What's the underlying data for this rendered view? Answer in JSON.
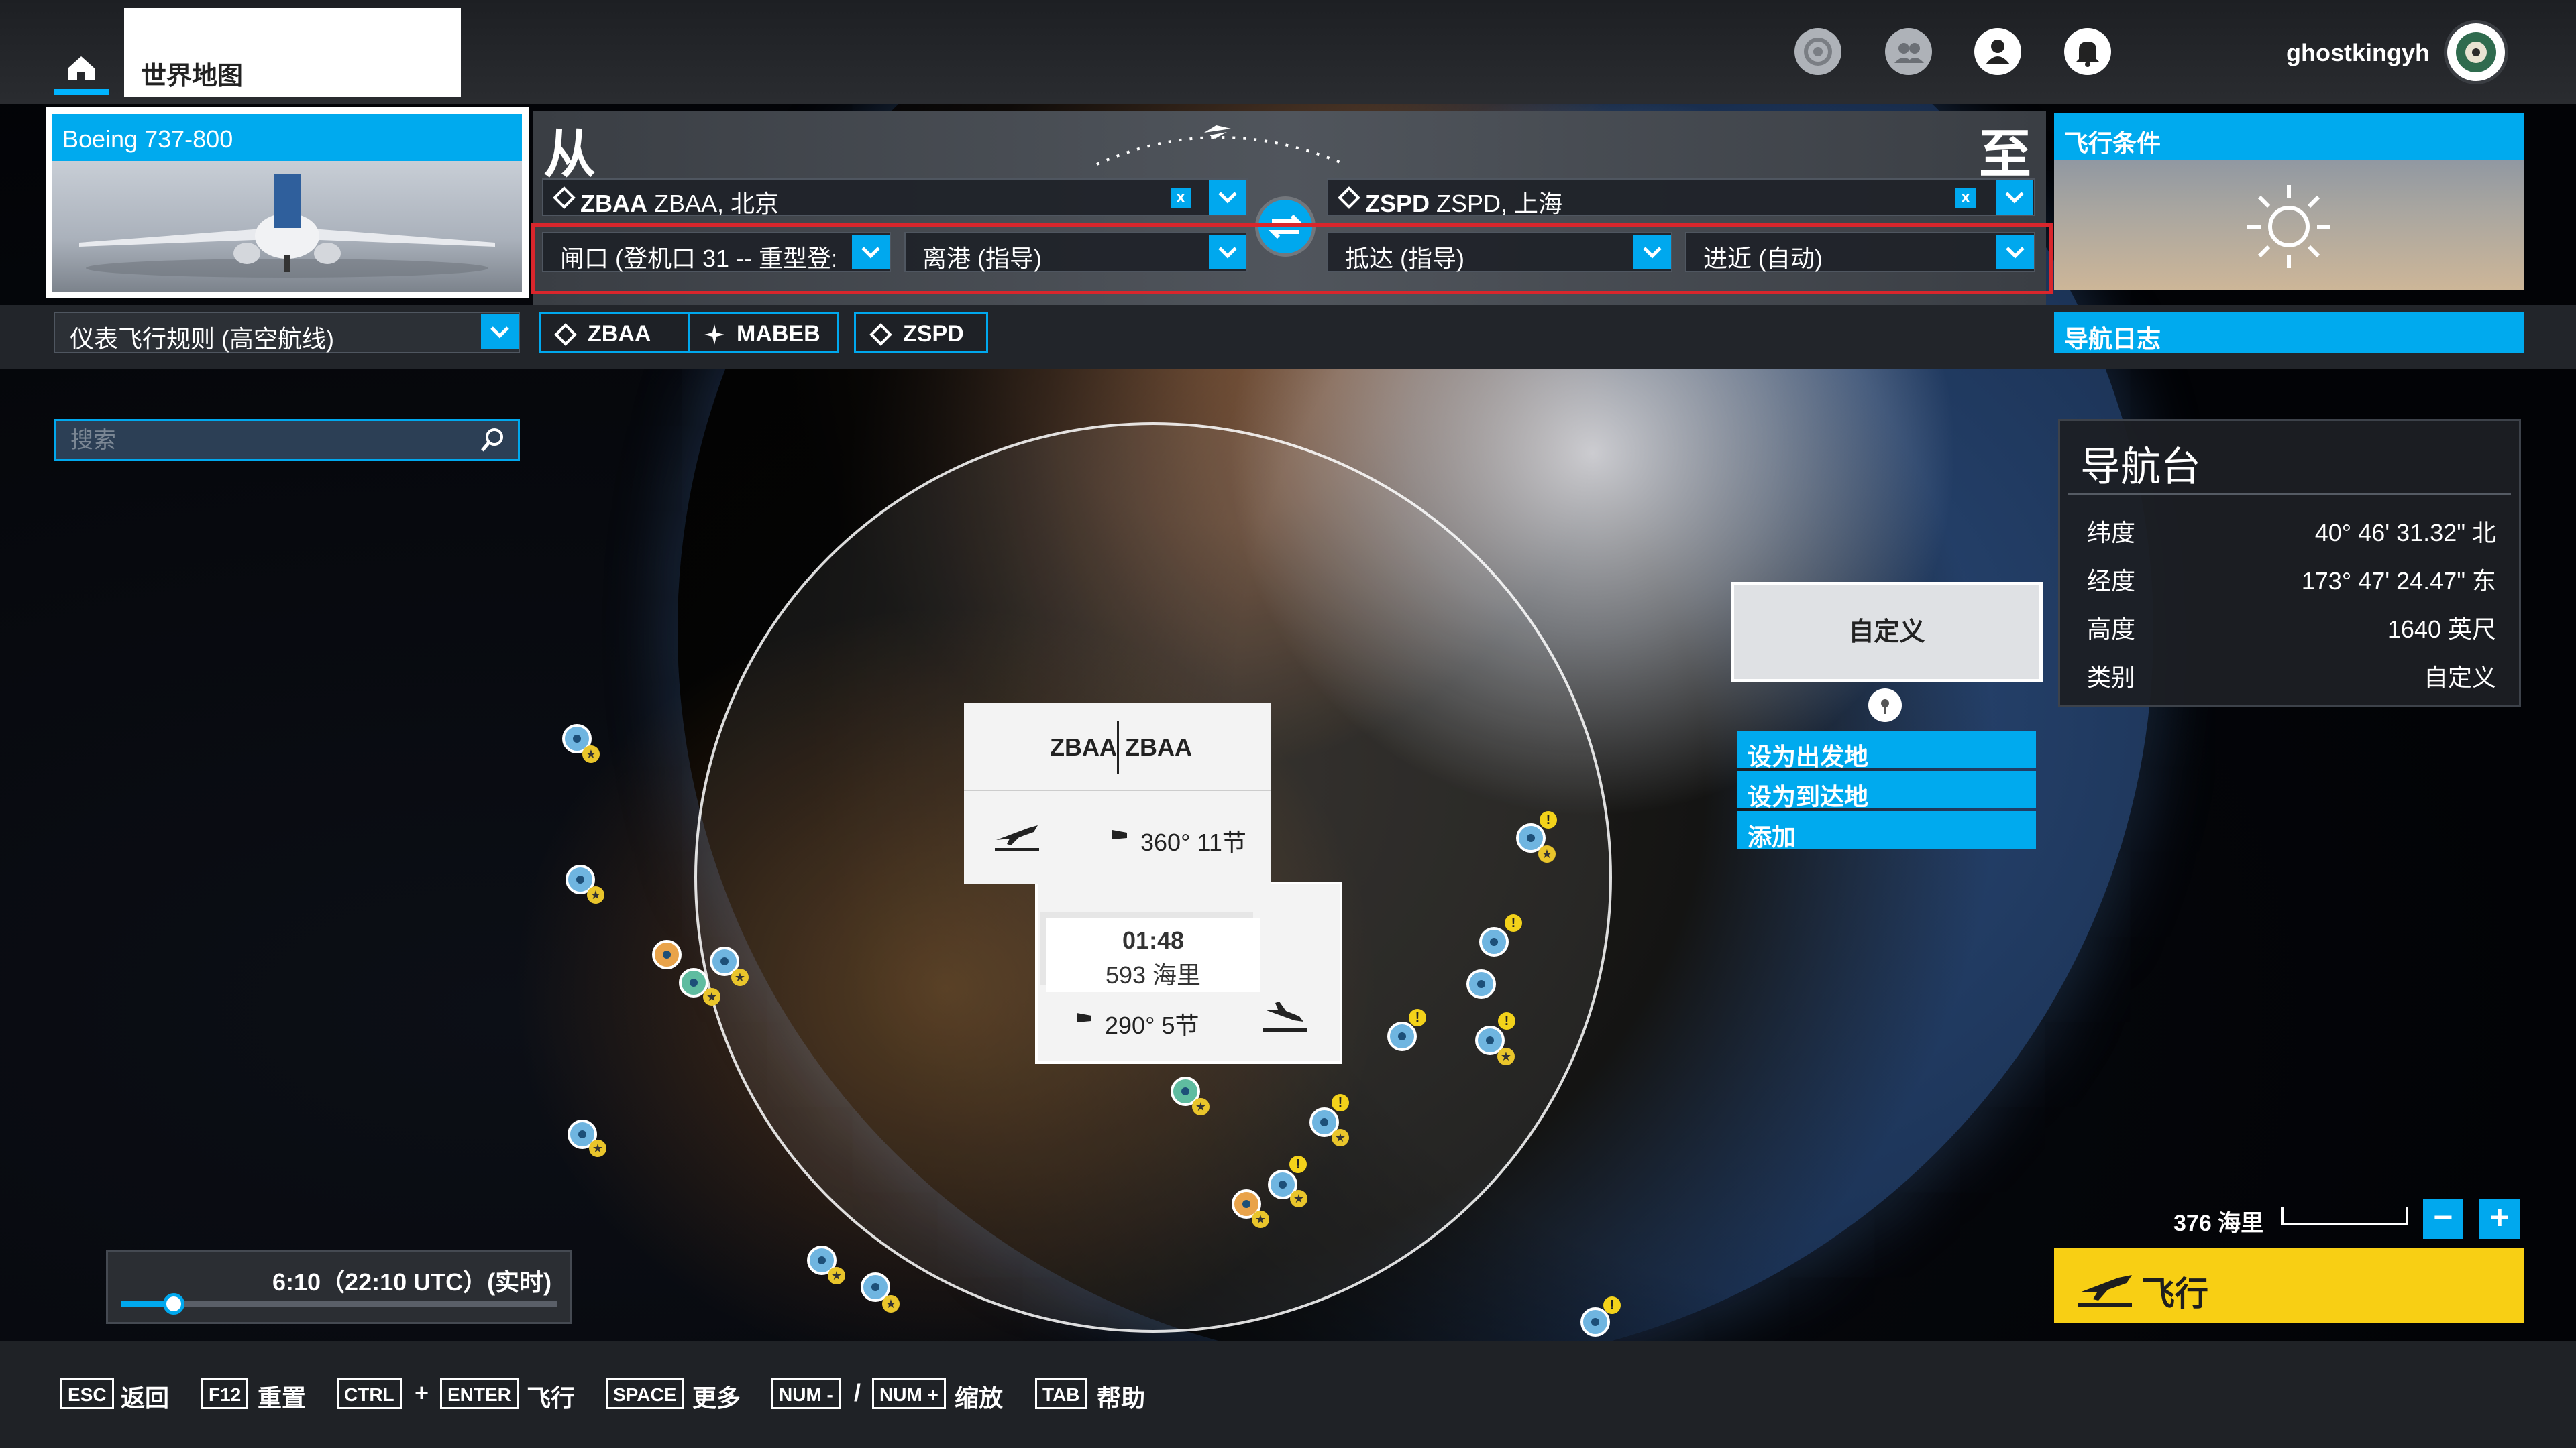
{
  "header": {
    "worldmap_tab": "世界地图",
    "username": "ghostkingyh"
  },
  "aircraft": {
    "name": "Boeing 737-800"
  },
  "route": {
    "from_label": "从",
    "to_label": "至",
    "departure": "ZBAA ZBAA, 北京",
    "departure_code": "ZBAA",
    "departure_name": "ZBAA, 北京",
    "arrival_code": "ZSPD",
    "arrival_name": "ZSPD, 上海",
    "clear": "x",
    "gate": "闸口 (登机口 31 -- 重型登:",
    "departure_proc": "离港 (指导)",
    "arrival_proc": "抵达 (指导)",
    "approach": "进近 (自动)"
  },
  "conditions": {
    "title": "飞行条件"
  },
  "flightplan": {
    "rules": "仪表飞行规则 (高空航线)",
    "waypoints": [
      "ZBAA",
      "MABEB",
      "ZSPD"
    ],
    "navlog": "导航日志"
  },
  "search": {
    "placeholder": "搜索"
  },
  "navpanel": {
    "title": "导航台",
    "rows": [
      {
        "k": "纬度",
        "v": "40° 46' 31.32\" 北"
      },
      {
        "k": "经度",
        "v": "173° 47' 24.47\" 东"
      },
      {
        "k": "高度",
        "v": "1640 英尺"
      },
      {
        "k": "类别",
        "v": "自定义"
      }
    ]
  },
  "custom_popup": {
    "title": "自定义",
    "actions": [
      "设为出发地",
      "设为到达地",
      "添加"
    ]
  },
  "dep_card": {
    "code_left": "ZBAA",
    "code_right": "ZBAA",
    "wind": "360° 11节"
  },
  "mid_card": {
    "time": "01:48",
    "distance": "593 海里"
  },
  "arr_card": {
    "wind": "290° 5节"
  },
  "map": {
    "scale": "376 海里",
    "zoom_out": "−",
    "zoom_in": "+"
  },
  "fly": {
    "label": "飞行"
  },
  "time": {
    "label": "6:10（22:10 UTC）(实时)",
    "progress": 0.12
  },
  "shortcuts": [
    {
      "key": "ESC",
      "label": "返回"
    },
    {
      "key": "F12",
      "label": "重置"
    },
    {
      "key": "CTRL",
      "label": "+"
    },
    {
      "key": "ENTER",
      "label": "飞行"
    },
    {
      "key": "SPACE",
      "label": "更多"
    },
    {
      "key": "NUM -",
      "label": "/"
    },
    {
      "key": "NUM +",
      "label": "缩放"
    },
    {
      "key": "TAB",
      "label": "帮助"
    }
  ],
  "colors": {
    "accent": "#00aaee",
    "fly_button": "#f8cf14",
    "highlight_box": "#d9262c"
  }
}
